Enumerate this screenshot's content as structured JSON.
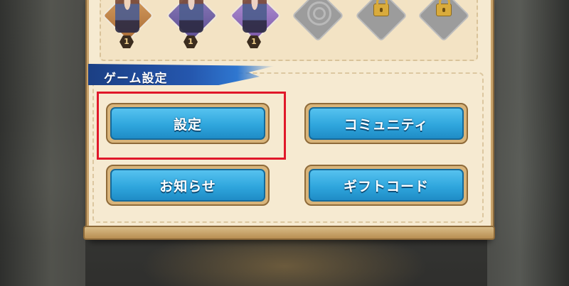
{
  "characters": [
    {
      "type": "hero",
      "color": "gold",
      "level": "1"
    },
    {
      "type": "hero",
      "color": "purple",
      "level": "1"
    },
    {
      "type": "hero",
      "color": "violet",
      "level": "1"
    },
    {
      "type": "empty",
      "icon": "swirl-icon"
    },
    {
      "type": "locked",
      "icon": "lock-icon"
    },
    {
      "type": "locked",
      "icon": "lock-icon"
    }
  ],
  "section": {
    "title": "ゲーム設定"
  },
  "buttons": {
    "settings": "設定",
    "community": "コミュニティ",
    "news": "お知らせ",
    "gift_code": "ギフトコード"
  },
  "colors": {
    "button_blue": "#2fa6dd",
    "panel_cream": "#f6ead1",
    "banner_blue": "#2557ae",
    "highlight_red": "#e0182a"
  }
}
